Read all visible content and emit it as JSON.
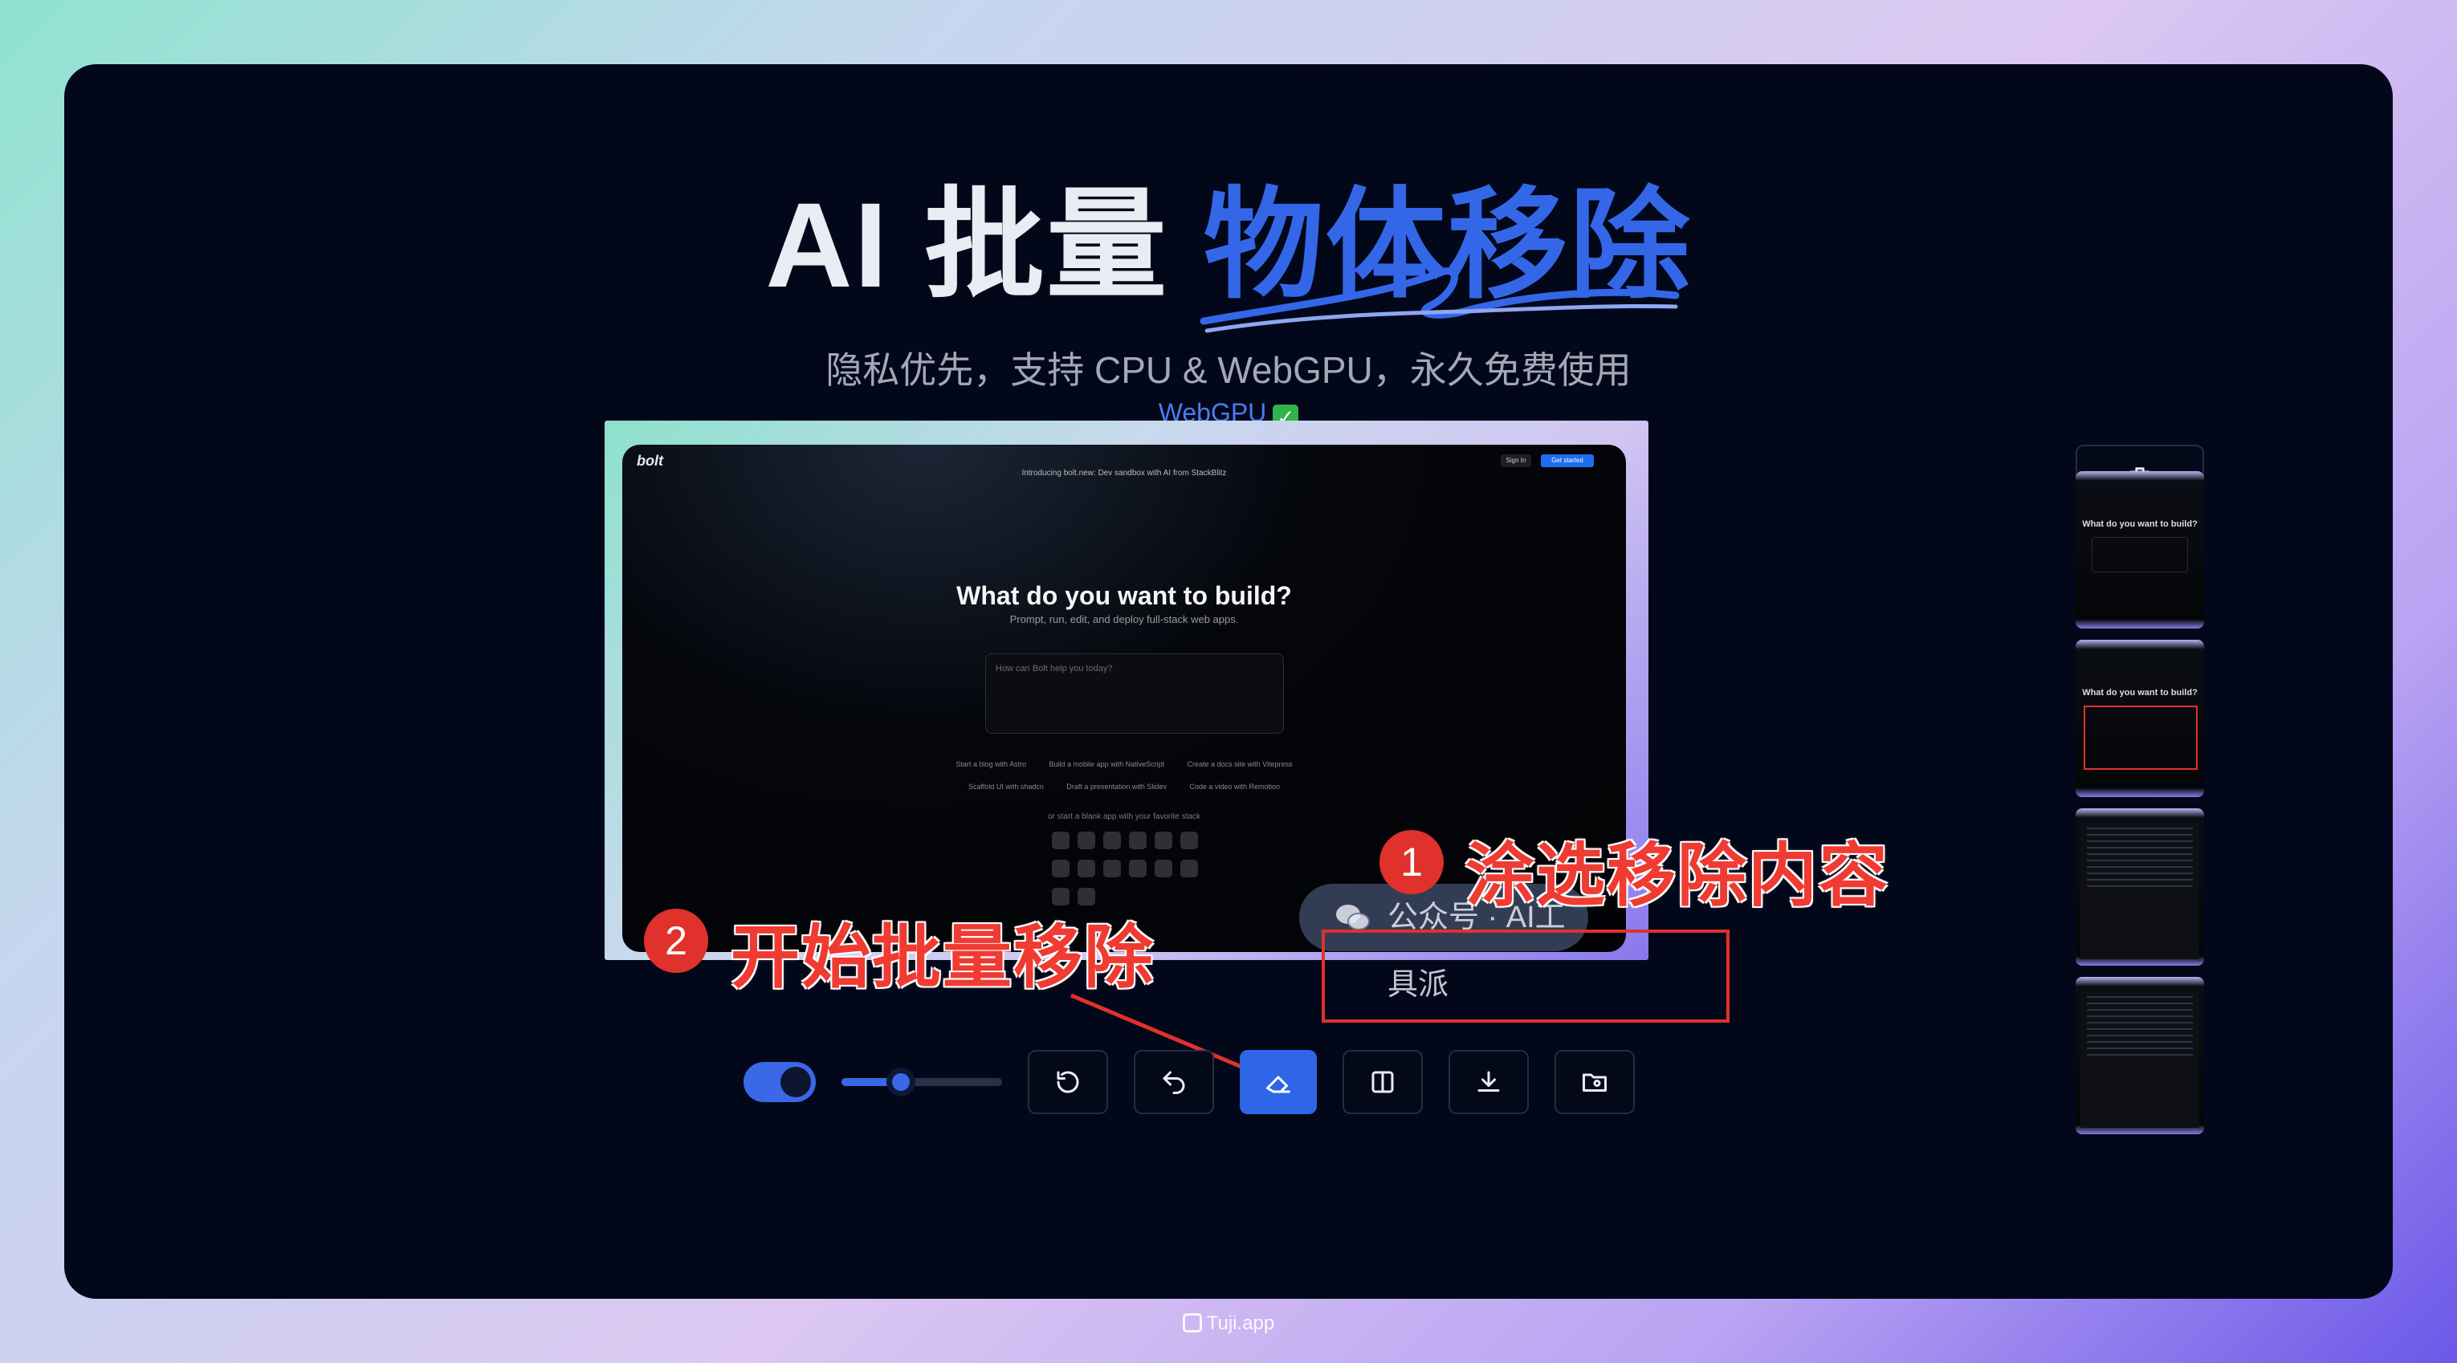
{
  "header": {
    "title_prefix": "AI 批量",
    "title_accent": "物体移除",
    "subtitle": "隐私优先，支持 CPU & WebGPU，永久免费使用",
    "webgpu_status": "WebGPU",
    "webgpu_check": "✓"
  },
  "preview": {
    "logo": "bolt",
    "announcement": "Introducing bolt.new: Dev sandbox with AI from StackBlitz",
    "sign_in": "Sign In",
    "get_started": "Get started",
    "headline": "What do you want to build?",
    "subheadline": "Prompt, run, edit, and deploy full-stack web apps.",
    "input_placeholder": "How can Bolt help you today?",
    "chips": [
      "Start a blog with Astro",
      "Build a mobile app with NativeScript",
      "Create a docs site with Vitepress",
      "Scaffold UI with shadcn",
      "Draft a presentation with Slidev",
      "Code a video with Remotion"
    ],
    "stack_hint": "or start a blank app with your favorite stack",
    "watermark": "公众号 · AI工具派"
  },
  "annotations": {
    "step1_number": "1",
    "step1_label": "涂选移除内容",
    "step2_number": "2",
    "step2_label": "开始批量移除",
    "annotation_color": "#e0312c"
  },
  "toolbar": {
    "auto_toggle_on": true,
    "brush_size_fraction": 0.37,
    "buttons": [
      {
        "name": "reset-icon"
      },
      {
        "name": "undo-icon"
      },
      {
        "name": "eraser-icon",
        "active": true
      },
      {
        "name": "compare-icon"
      },
      {
        "name": "download-icon"
      },
      {
        "name": "folder-image-icon"
      }
    ],
    "accent": "#2f66e8"
  },
  "sidebar": {
    "delete_icon": "trash-icon",
    "thumbnail_count": 4,
    "thumbnail_text": "What do you want to build?"
  },
  "footer": {
    "brand": "Tuji.app"
  }
}
